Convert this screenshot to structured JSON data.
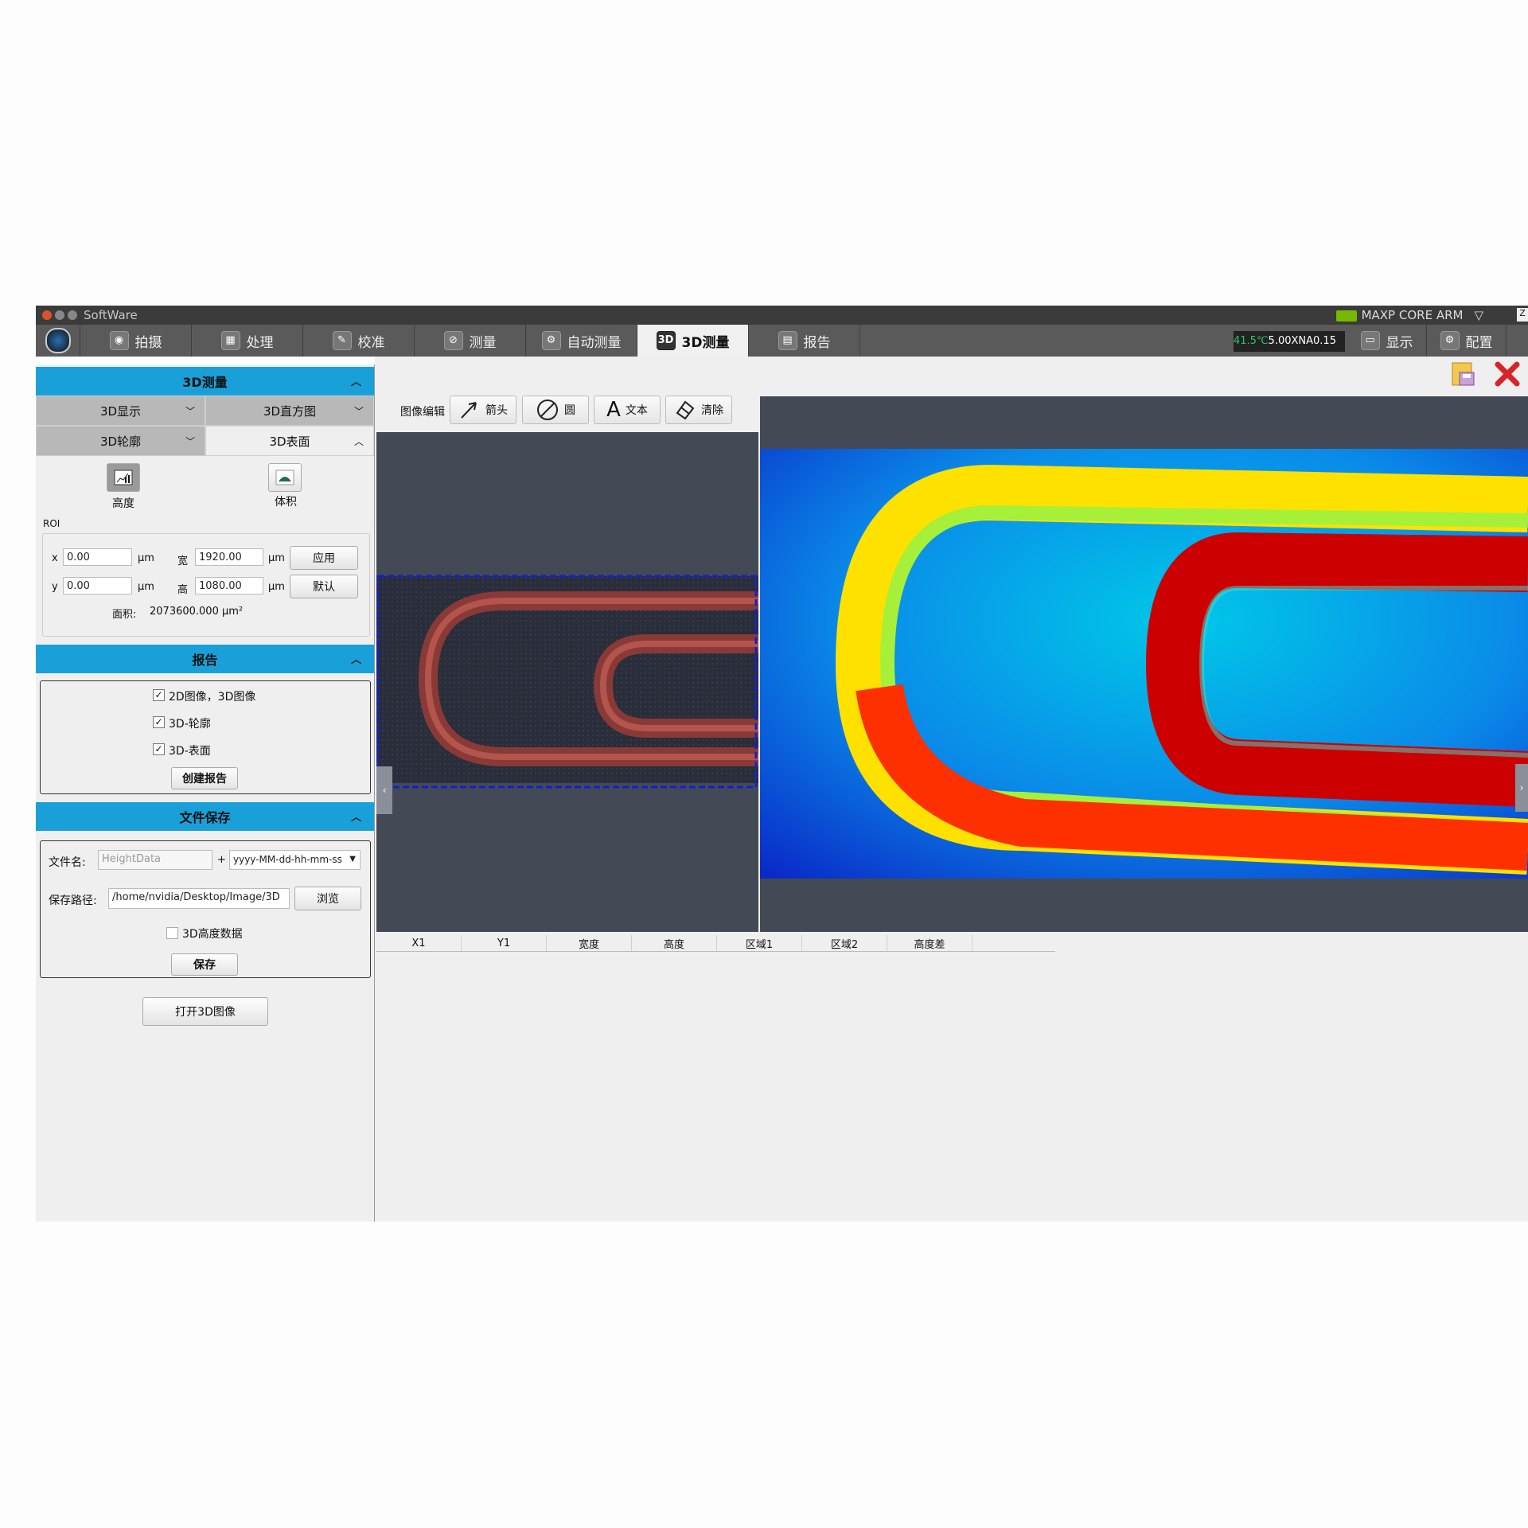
{
  "title_bar": {
    "title": "SoftWare",
    "system_label": "MAXP CORE ARM"
  },
  "tabs": [
    {
      "label": "拍摄",
      "icon": "camera-icon"
    },
    {
      "label": "处理",
      "icon": "image-process-icon"
    },
    {
      "label": "校准",
      "icon": "ruler-icon"
    },
    {
      "label": "测量",
      "icon": "measure-icon"
    },
    {
      "label": "自动测量",
      "icon": "gears-icon"
    },
    {
      "label": "3D测量",
      "icon": "3d-icon",
      "active": true
    },
    {
      "label": "报告",
      "icon": "report-icon"
    }
  ],
  "status": {
    "temperature": "41.5℃",
    "lens": "5.00XNA0.15"
  },
  "right_tabs": [
    {
      "label": "显示",
      "icon": "monitor-icon"
    },
    {
      "label": "配置",
      "icon": "settings-icon"
    }
  ],
  "panel_3d": {
    "header": "3D测量",
    "subtabs": [
      "3D显示",
      "3D直方图",
      "3D轮廓",
      "3D表面"
    ],
    "tools": [
      {
        "label": "高度"
      },
      {
        "label": "体积"
      }
    ],
    "roi_label": "ROI",
    "x_label": "x",
    "x_value": "0.00",
    "y_label": "y",
    "y_value": "0.00",
    "width_label": "宽",
    "width_value": "1920.00",
    "height_label": "高",
    "height_value": "1080.00",
    "unit": "μm",
    "apply_button": "应用",
    "default_button": "默认",
    "area_label": "面积:",
    "area_value": "2073600.000 μm²"
  },
  "panel_report": {
    "header": "报告",
    "checks": [
      {
        "label": "2D图像，3D图像",
        "checked": true
      },
      {
        "label": "3D-轮廓",
        "checked": true
      },
      {
        "label": "3D-表面",
        "checked": true
      }
    ],
    "create_button": "创建报告"
  },
  "panel_save": {
    "header": "文件保存",
    "filename_label": "文件名:",
    "filename_placeholder": "HeightData",
    "plus": "+",
    "format_value": "yyyy-MM-dd-hh-mm-ss",
    "path_label": "保存路径:",
    "path_value": "/home/nvidia/Desktop/Image/3D",
    "browse_button": "浏览",
    "height_data_label": "3D高度数据",
    "height_data_checked": false,
    "save_button": "保存"
  },
  "open_3d_button": "打开3D图像",
  "image_toolbar": {
    "label": "图像编辑",
    "arrow": "箭头",
    "circle": "圆",
    "text": "文本",
    "clear": "清除"
  },
  "table_headers": [
    "X1",
    "Y1",
    "宽度",
    "高度",
    "区域1",
    "区域2",
    "高度差"
  ]
}
